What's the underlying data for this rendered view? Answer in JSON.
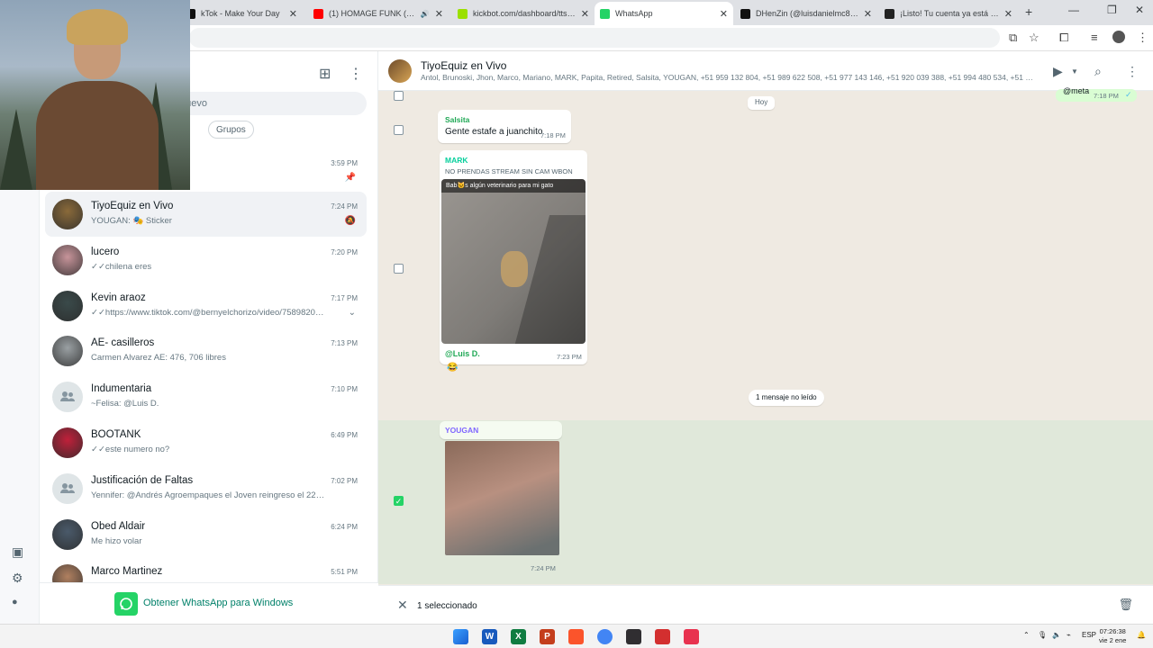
{
  "browser": {
    "tabs": [
      {
        "label": "kTok - Make Your Day",
        "active": false,
        "favicon_color": "#111111"
      },
      {
        "label": "(1) HOMAGE FUNK (SLOWE",
        "active": false,
        "favicon_color": "#ff0000",
        "audio": true
      },
      {
        "label": "kickbot.com/dashboard/tts/se",
        "active": false,
        "favicon_color": "#9be000"
      },
      {
        "label": "WhatsApp",
        "active": true,
        "favicon_color": "#25d366"
      },
      {
        "label": "DHenZin (@luisdanielmc8) | Tik",
        "active": false,
        "favicon_color": "#111111"
      },
      {
        "label": "¡Listo! Tu cuenta ya está conec",
        "active": false,
        "favicon_color": "#222222"
      }
    ],
    "new_tab_symbol": "+"
  },
  "sidebar_search": {
    "placeholder": "nuevo"
  },
  "filter_chips": [
    {
      "label": "s"
    },
    {
      "label": "Grupos"
    }
  ],
  "pinned_row": {
    "time": "3:59 PM"
  },
  "chats": [
    {
      "name": "TiyoEquiz en Vivo",
      "preview": "YOUGAN: 🎭 Sticker",
      "time": "7:24 PM",
      "selected": true,
      "icon": "muted-bell-icon",
      "avatar": "photo",
      "avatar_color": "#8a6a3a"
    },
    {
      "name": "lucero",
      "preview": "✓✓chilena eres",
      "time": "7:20 PM",
      "avatar": "photo",
      "avatar_color": "#c7949a"
    },
    {
      "name": "Kevin araoz",
      "preview": "✓✓https://www.tiktok.com/@bernyelchorizo/video/7589820216…",
      "time": "7:17 PM",
      "icon": "chevron-down-icon",
      "avatar": "photo",
      "avatar_color": "#3a4a4a"
    },
    {
      "name": "AE- casilleros",
      "preview": "Carmen Alvarez AE: 476, 706 libres",
      "time": "7:13 PM",
      "avatar": "photo",
      "avatar_color": "#9aa0a3"
    },
    {
      "name": "Indumentaria",
      "preview": "~Felisa: @Luis D.",
      "time": "7:10 PM",
      "avatar": "group"
    },
    {
      "name": "BOOTANK",
      "preview": "✓✓este numero no?",
      "time": "6:49 PM",
      "avatar": "photo",
      "avatar_color": "#c0203a"
    },
    {
      "name": "Justificación de Faltas",
      "preview": "Yennifer: @Andrés Agroempaques el Joven reingreso el 22/12.  El cu…",
      "time": "7:02 PM",
      "avatar": "group"
    },
    {
      "name": "Obed Aldair",
      "preview": "Me hizo volar",
      "time": "6:24 PM",
      "avatar": "photo",
      "avatar_color": "#4a5a6a"
    },
    {
      "name": "Marco Martinez",
      "preview": "Jaaaaaaaaaaaaaaaaa",
      "time": "5:51 PM",
      "avatar": "photo",
      "avatar_color": "#b08060"
    }
  ],
  "banner": {
    "label": "Obtener WhatsApp para Windows"
  },
  "chat": {
    "title": "TiyoEquiz en Vivo",
    "members": "Antol, Brunoski, Jhon, Marco, Mariano, MARK, Papita, Retired, Salsita, YOUGAN, +51 959 132 804, +51 989 622 508, +51 977 143 146, +51 920 039 388, +51 994 480 534, +51 9…",
    "outgoing_preview": {
      "text": "@meta",
      "time": "7:18 PM"
    },
    "day_label": "Hoy",
    "messages": [
      {
        "sender": "Salsita",
        "sender_color": "#1fa855",
        "text": "Gente estafe a juanchito",
        "time": "7:18 PM"
      },
      {
        "sender": "MARK",
        "sender_color": "#06cf9c",
        "quote": "NO PRENDAS STREAM SIN CAM WBON",
        "image_caption": "Bab🐱s algún veterinario para mi gato",
        "mention": "@Luis D.",
        "time": "7:23 PM",
        "reaction": "😂"
      },
      {
        "sender": "YOUGAN",
        "sender_color": "#7f66ff",
        "time": "7:24 PM"
      }
    ],
    "unread_label": "1 mensaje no leído",
    "selection": {
      "label": "1 seleccionado",
      "checked_symbol": "✓"
    }
  },
  "taskbar": {
    "apps": [
      {
        "icon": "windows-start-icon",
        "color": "#1a73e8"
      },
      {
        "icon": "word-icon",
        "color": "#185abd",
        "letter": "W"
      },
      {
        "icon": "excel-icon",
        "color": "#107c41",
        "letter": "X"
      },
      {
        "icon": "powerpoint-icon",
        "color": "#c43e1c",
        "letter": "P"
      },
      {
        "icon": "brave-icon",
        "color": "#fb542b"
      },
      {
        "icon": "chrome-icon",
        "color": "#4285f4"
      },
      {
        "icon": "obs-icon",
        "color": "#302e31"
      },
      {
        "icon": "app-red-icon",
        "color": "#d32f2f"
      },
      {
        "icon": "app-pink-icon",
        "color": "#e8324f"
      }
    ],
    "language": "ESP",
    "time": "07:26:38",
    "date": "vie 2 ene"
  }
}
